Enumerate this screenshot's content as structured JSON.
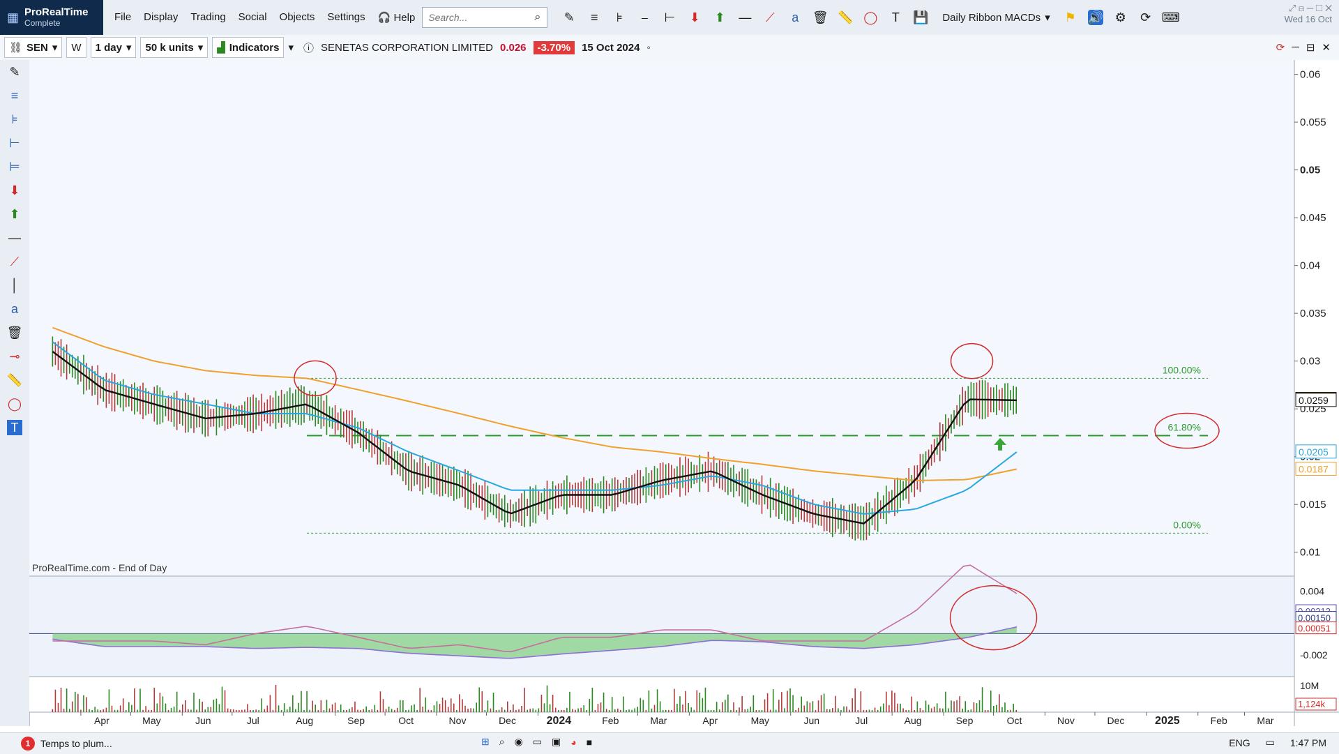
{
  "app": {
    "name": "ProRealTime",
    "edition": "Complete",
    "date_readout": "Wed 16 Oct"
  },
  "menu": {
    "items": [
      "File",
      "Display",
      "Trading",
      "Social",
      "Objects",
      "Settings"
    ],
    "help": "Help"
  },
  "search": {
    "placeholder": "Search..."
  },
  "toolbar": {
    "template_selector": "Daily Ribbon MACDs",
    "icons": [
      "pencil-icon",
      "horizontal-line-icon",
      "fib-icon",
      "trend-icon",
      "fan-icon",
      "sell-arrow-icon",
      "buy-arrow-icon",
      "line-icon",
      "segment-icon",
      "text-abc-icon",
      "trash-icon",
      "ruler-icon",
      "ellipse-icon",
      "text-T-icon",
      "save-icon",
      "flag-icon",
      "speaker-icon",
      "gear-icon",
      "refresh-icon",
      "keyboard-icon"
    ]
  },
  "instrument_bar": {
    "ticker": "SEN",
    "w_label": "W",
    "interval": "1 day",
    "units": "50 k units",
    "indicators_label": "Indicators",
    "company": "SENETAS CORPORATION LIMITED",
    "last_price": "0.026",
    "change": "-3.70%",
    "quote_date": "15 Oct 2024"
  },
  "chart": {
    "watermark": "ProRealTime.com - End of Day",
    "price_axis_labels": [
      "0.06",
      "0.055",
      "0.05",
      "0.045",
      "0.04",
      "0.035",
      "0.03",
      "0.025",
      "0.02",
      "0.015",
      "0.01"
    ],
    "price_axis_ymin": 0.0075,
    "price_axis_ymax": 0.0615,
    "price_tags": {
      "last": "0.026",
      "ma_black": "0.0259",
      "ma_blue": "0.0205",
      "ma_orange": "0.0187"
    },
    "fib_levels": {
      "100": {
        "label": "100.00%",
        "price": 0.0282
      },
      "61.8": {
        "label": "61.80%",
        "price": 0.0222
      },
      "0": {
        "label": "0.00%",
        "price": 0.012
      }
    },
    "x_axis_labels": [
      "Apr",
      "May",
      "Jun",
      "Jul",
      "Aug",
      "Sep",
      "Oct",
      "Nov",
      "Dec",
      "2024",
      "Feb",
      "Mar",
      "Apr",
      "May",
      "Jun",
      "Jul",
      "Aug",
      "Sep",
      "Oct",
      "Nov",
      "Dec",
      "2025",
      "Feb",
      "Mar"
    ],
    "macd_axis_labels": [
      "0.004",
      "-0.002"
    ],
    "macd_tags": [
      "0.00213",
      "0.00150",
      "0.00051"
    ],
    "volume_axis_labels": [
      "10M"
    ],
    "volume_tag": "1,124k",
    "colors": {
      "up_bar": "#2a8a1f",
      "down_bar": "#b23a3a",
      "ma_black": "#111111",
      "ma_blue": "#2aa7e0",
      "ma_orange": "#f0a12c",
      "fib_line": "#2c9a2c",
      "annotation": "#d22b2b"
    }
  },
  "chart_data": {
    "type": "line",
    "title": "SENETAS CORPORATION LIMITED",
    "x_dates": [
      "2023-03-15",
      "2023-04-15",
      "2023-05-15",
      "2023-06-15",
      "2023-07-15",
      "2023-08-15",
      "2023-09-15",
      "2023-10-15",
      "2023-11-15",
      "2023-12-15",
      "2024-01-15",
      "2024-02-15",
      "2024-03-15",
      "2024-04-15",
      "2024-05-15",
      "2024-06-15",
      "2024-07-15",
      "2024-08-15",
      "2024-09-15",
      "2024-10-15"
    ],
    "series": [
      {
        "values": [
          0.031,
          0.027,
          0.0255,
          0.024,
          0.0245,
          0.0255,
          0.0225,
          0.0185,
          0.017,
          0.014,
          0.016,
          0.016,
          0.0175,
          0.0185,
          0.016,
          0.014,
          0.013,
          0.0175,
          0.026,
          0.0259
        ]
      },
      {
        "values": [
          0.032,
          0.028,
          0.0265,
          0.0255,
          0.0245,
          0.0245,
          0.023,
          0.0205,
          0.0185,
          0.0165,
          0.0165,
          0.0165,
          0.017,
          0.018,
          0.017,
          0.015,
          0.014,
          0.0145,
          0.0165,
          0.0205
        ]
      },
      {
        "values": [
          0.0335,
          0.0315,
          0.03,
          0.029,
          0.0285,
          0.0282,
          0.027,
          0.0258,
          0.0245,
          0.0232,
          0.022,
          0.021,
          0.0205,
          0.0198,
          0.0192,
          0.0185,
          0.018,
          0.0175,
          0.0176,
          0.0187
        ]
      }
    ],
    "fib_retracement": {
      "high": 0.0282,
      "low": 0.012,
      "level_61_8": 0.0222
    },
    "ylim": [
      0.0075,
      0.0615
    ]
  },
  "taskbar": {
    "notification_count": "1",
    "task_label": "Temps to plum...",
    "language": "ENG",
    "time": "1:47 PM"
  }
}
